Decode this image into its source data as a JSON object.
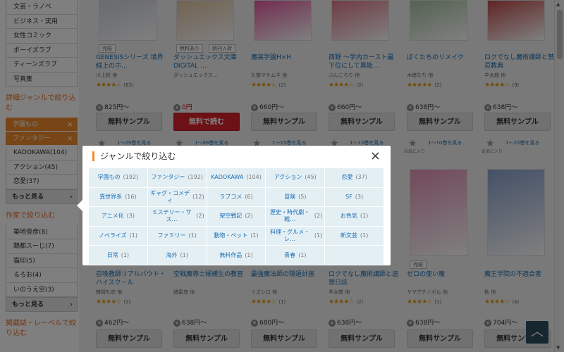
{
  "sidebar": {
    "top_items": [
      {
        "label": "文芸・ラノベ"
      },
      {
        "label": "ビジネス・実用"
      },
      {
        "label": "女性コミック"
      },
      {
        "label": "ボーイズラブ"
      },
      {
        "label": "ティーンズラブ"
      },
      {
        "label": "写真集"
      }
    ],
    "detail_heading": "詳細ジャンルで絞り込む",
    "selected_chips": [
      {
        "label": "学園もの"
      },
      {
        "label": "ファンタジー"
      }
    ],
    "chip_remove": "×",
    "genre_items": [
      {
        "label": "KADOKAWA(104)"
      },
      {
        "label": "アクション(45)"
      },
      {
        "label": "恋愛(37)"
      }
    ],
    "more_label": "もっと見る",
    "author_heading": "作家で絞り込む",
    "author_items": [
      {
        "label": "築地俊彦(8)"
      },
      {
        "label": "鵜都スーじ(7)"
      },
      {
        "label": "猫印(5)"
      },
      {
        "label": "るろお(4)"
      },
      {
        "label": "いのうえ空(3)"
      }
    ],
    "more_label2": "もっと見る",
    "magazine_heading": "掲載誌・レーベルで絞り込む"
  },
  "products_top": [
    {
      "badge": "完結",
      "badge2": "",
      "title": "GENESISシリーズ 境界線上のホ…",
      "author": "川上稔 他",
      "stars": "★★★★☆",
      "rating_count": "(63)",
      "price": "825円〜",
      "free": false,
      "button": "無料サンプル",
      "red": false,
      "cover_color": "#cfd4de",
      "vol_label": "1〜29巻を見る"
    },
    {
      "badge": "無料あり",
      "badge2": "続刊入荷",
      "title": "ダッシュエックス文庫DIGITAL …",
      "author": "ダッシュエックス…",
      "stars": "",
      "rating_count": "",
      "price": "0円",
      "free": true,
      "button": "無料で読む",
      "red": true,
      "cover_color": "#e4c6a2",
      "vol_label": "1〜68巻を見る"
    },
    {
      "badge": "",
      "badge2": "",
      "title": "魔装学園H×H",
      "author": "久慈マサムネ 他",
      "stars": "★★★★☆",
      "rating_count": "(2)",
      "price": "660円〜",
      "free": false,
      "button": "無料サンプル",
      "red": false,
      "cover_color": "#e55aa0",
      "vol_label": "1〜15巻を見る"
    },
    {
      "badge": "",
      "badge2": "",
      "title": "西野 〜学内カースト最下位にして異能…",
      "author": "ぶんころり 他",
      "stars": "★★★★☆",
      "rating_count": "(2)",
      "price": "660円〜",
      "free": false,
      "button": "無料サンプル",
      "red": false,
      "cover_color": "#e07a8a",
      "vol_label": "1〜13巻を見る"
    },
    {
      "badge": "",
      "badge2": "",
      "title": "ぼくたちのリメイク",
      "author": "木緒なち 他",
      "stars": "★★★★★",
      "rating_count": "(2)",
      "price": "638円〜",
      "free": false,
      "button": "無料サンプル",
      "red": false,
      "cover_color": "#a9c7a4",
      "vol_label": "1〜10巻を見る"
    },
    {
      "badge": "",
      "badge2": "",
      "title": "ロクでなし魔術講師と禁忌教典",
      "author": "羊太郎 他",
      "stars": "★★★★☆",
      "rating_count": "(9)",
      "price": "638円〜",
      "free": false,
      "button": "無料サンプル",
      "red": false,
      "cover_color": "#c24a4a",
      "vol_label": "1〜20巻を見る"
    }
  ],
  "products_bottom": [
    {
      "badge": "",
      "title": "召喚教師リアルバウト・ハイスクール",
      "author": "雑賀礼史 他",
      "stars": "★★★★☆",
      "rating_count": "(2)",
      "price": "462円〜",
      "button": "無料サンプル",
      "cover_color": "#9aa6c0"
    },
    {
      "badge": "",
      "title": "空戦魔導士候補生の教官",
      "author": "諸星悠 他",
      "stars": "",
      "rating_count": "",
      "price": "638円〜",
      "button": "無料サンプル",
      "cover_color": "#7fa3c9"
    },
    {
      "badge": "",
      "title": "最強魔法師の隠遁計画",
      "author": "イズシロ 他",
      "stars": "★★★★☆",
      "rating_count": "(1)",
      "price": "680円〜",
      "button": "無料サンプル",
      "cover_color": "#a3b7d6"
    },
    {
      "badge": "",
      "title": "ロクでなし魔術講師と追想日誌",
      "author": "羊太郎 他",
      "stars": "★★★★☆",
      "rating_count": "(2)",
      "price": "638円〜",
      "button": "無料サンプル",
      "cover_color": "#c9a27e"
    },
    {
      "badge": "完結",
      "title": "ゼロの使い魔",
      "author": "ヤマグチノボル 他",
      "stars": "★★★★☆",
      "rating_count": "(1)",
      "price": "638円〜",
      "button": "無料サンプル",
      "cover_color": "#e594b8"
    },
    {
      "badge": "",
      "title": "魔王学院の不適合者",
      "author": "秋 他",
      "stars": "★★★★☆",
      "rating_count": "(4)",
      "price": "704円〜",
      "button": "無料サンプル",
      "cover_color": "#8aa3cf"
    }
  ],
  "fav_label": "お気に入り",
  "modal": {
    "title": "ジャンルで絞り込む",
    "close_icon": "×",
    "genres": [
      {
        "name": "学園もの",
        "count": "(192)"
      },
      {
        "name": "ファンタジー",
        "count": "(192)"
      },
      {
        "name": "KADOKAWA",
        "count": "(104)"
      },
      {
        "name": "アクション",
        "count": "(45)"
      },
      {
        "name": "恋愛",
        "count": "(37)"
      },
      {
        "name": "異世界系",
        "count": "(16)"
      },
      {
        "name": "ギャグ・コメディ",
        "count": "(12)"
      },
      {
        "name": "ラブコメ",
        "count": "(6)"
      },
      {
        "name": "冒険",
        "count": "(5)"
      },
      {
        "name": "SF",
        "count": "(3)"
      },
      {
        "name": "アニメ化",
        "count": "(3)"
      },
      {
        "name": "ミステリー・サス…",
        "count": "(2)"
      },
      {
        "name": "架空戦記",
        "count": "(2)"
      },
      {
        "name": "歴史・時代劇・戦…",
        "count": "(2)"
      },
      {
        "name": "お色気",
        "count": "(1)"
      },
      {
        "name": "ノベライズ",
        "count": "(1)"
      },
      {
        "name": "ファミリー",
        "count": "(1)"
      },
      {
        "name": "動物・ペット",
        "count": "(1)"
      },
      {
        "name": "料理・グルメ・レ…",
        "count": "(1)"
      },
      {
        "name": "新文芸",
        "count": "(1)"
      },
      {
        "name": "日常",
        "count": "(1)"
      },
      {
        "name": "海外",
        "count": "(1)"
      },
      {
        "name": "無料作品",
        "count": "(1)"
      },
      {
        "name": "青春",
        "count": "(1)"
      },
      {
        "name": "",
        "count": ""
      }
    ]
  },
  "back_to_top_icon": "chevron-up-icon",
  "colors": {
    "accent": "#f08a2c",
    "link": "#1a6fb5",
    "free_button": "#d9222a",
    "modal_cell": "#e4eff4"
  }
}
